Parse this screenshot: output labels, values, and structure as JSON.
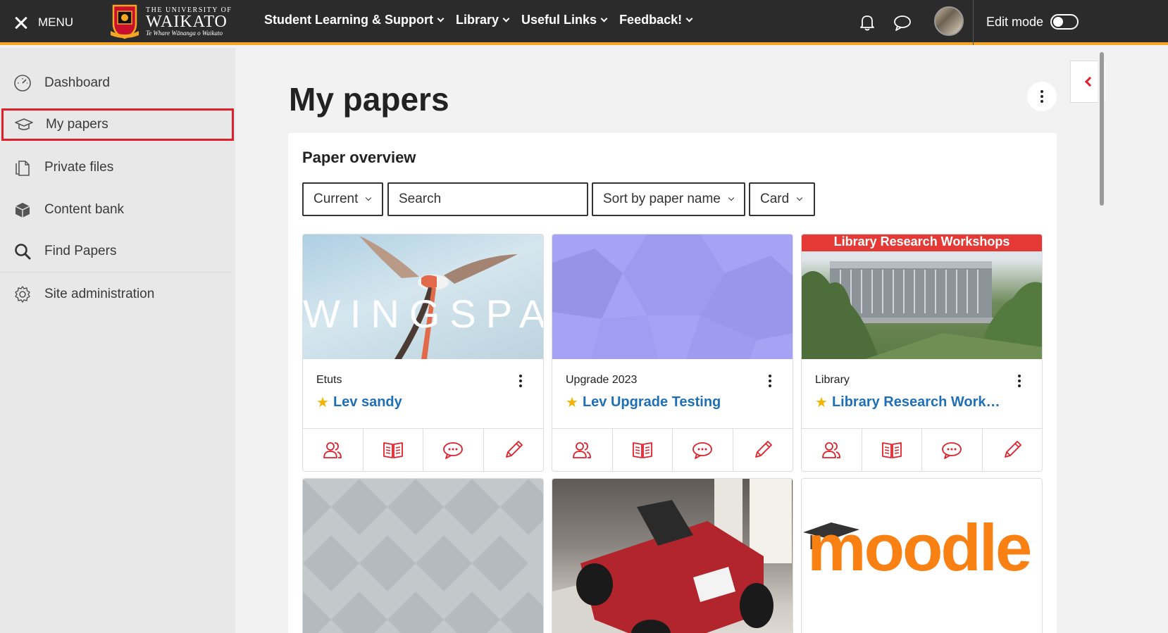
{
  "navbar": {
    "menu_label": "MENU",
    "logo": {
      "top": "THE UNIVERSITY OF",
      "main": "WAIKATO",
      "sub": "Te Whare Wānanga o Waikato"
    },
    "links": [
      "Student Learning & Support",
      "Library",
      "Useful Links",
      "Feedback!"
    ],
    "edit_mode_label": "Edit mode"
  },
  "sidebar": {
    "items": [
      {
        "label": "Dashboard",
        "icon": "dashboard-icon"
      },
      {
        "label": "My papers",
        "icon": "graduation-cap-icon"
      },
      {
        "label": "Private files",
        "icon": "files-icon"
      },
      {
        "label": "Content bank",
        "icon": "cube-icon"
      },
      {
        "label": "Find Papers",
        "icon": "search-icon"
      },
      {
        "label": "Site administration",
        "icon": "gear-icon"
      }
    ]
  },
  "main": {
    "title": "My papers",
    "overview_title": "Paper overview",
    "filters": {
      "grouping": "Current",
      "search_placeholder": "Search",
      "sort": "Sort by paper name",
      "view": "Card"
    },
    "cards": [
      {
        "category": "Etuts",
        "name": "Lev sandy",
        "image_text": "WINGSPAN",
        "starred": true
      },
      {
        "category": "Upgrade 2023",
        "name": "Lev Upgrade Testing",
        "starred": true
      },
      {
        "category": "Library",
        "name": "Library Research Workshops",
        "banner": "Library Research Workshops",
        "starred": true
      },
      {
        "category": "",
        "name": ""
      },
      {
        "category": "",
        "name": ""
      },
      {
        "category": "",
        "name": "",
        "image_text": "moodle"
      }
    ]
  },
  "colors": {
    "accent": "#f5a623",
    "navbar": "#2b2b2b",
    "link": "#1e6fb6",
    "icon_red": "#e0202a",
    "star": "#f5b400"
  }
}
